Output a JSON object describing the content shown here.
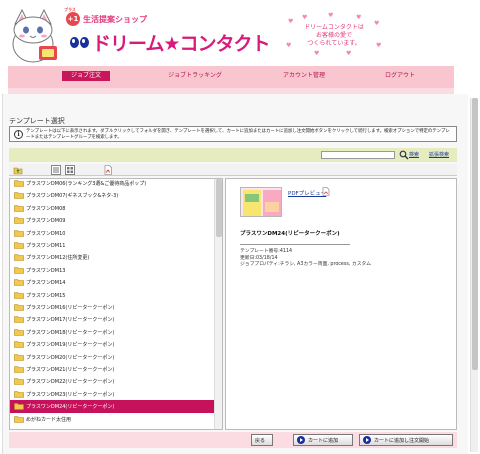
{
  "header": {
    "brand_badge_top": "プラス",
    "brand_badge": "+1",
    "brand_sub": "生活提案ショップ",
    "brand_main": "ドリーム★コンタクト",
    "tagline_line1": "ドリームコンタクトは",
    "tagline_line2": "お客様の愛で",
    "tagline_line3": "つくられています。"
  },
  "nav": {
    "items": [
      {
        "label": "ジョブ注文"
      },
      {
        "label": "ジョブトラッキング"
      },
      {
        "label": "アカウント管理"
      },
      {
        "label": "ログアウト"
      }
    ]
  },
  "page": {
    "title": "テンプレート選択",
    "info_text": "テンプレートは以下に表示されます。ダブルクリックしてフォルダを開き、テンプレートを選択して、カートに追加またはカートに追加し注文開始ボタンをクリックして続行します。検索オプションで特定のテンプレートまたはテンプレートグループを検索します。"
  },
  "search": {
    "placeholder": "",
    "search_label": "検索",
    "advanced_label": "拡張検索"
  },
  "tree": {
    "items": [
      {
        "label": "プラスワンDM06(ランキング3選&ご優待商品ポップ)",
        "selected": false
      },
      {
        "label": "プラスワンDM07(ギネスブック&ネタ-3)",
        "selected": false
      },
      {
        "label": "プラスワンDM08",
        "selected": false
      },
      {
        "label": "プラスワンDM09",
        "selected": false
      },
      {
        "label": "プラスワンDM10",
        "selected": false
      },
      {
        "label": "プラスワンDM11",
        "selected": false
      },
      {
        "label": "プラスワンDM12(住所変更)",
        "selected": false
      },
      {
        "label": "プラスワンDM13",
        "selected": false
      },
      {
        "label": "プラスワンDM14",
        "selected": false
      },
      {
        "label": "プラスワンDM15",
        "selected": false
      },
      {
        "label": "プラスワンDM16(リピータークーポン)",
        "selected": false
      },
      {
        "label": "プラスワンDM17(リピータークーポン)",
        "selected": false
      },
      {
        "label": "プラスワンDM18(リピータークーポン)",
        "selected": false
      },
      {
        "label": "プラスワンDM19(リピータークーポン)",
        "selected": false
      },
      {
        "label": "プラスワンDM20(リピータークーポン)",
        "selected": false
      },
      {
        "label": "プラスワンDM21(リピータークーポン)",
        "selected": false
      },
      {
        "label": "プラスワンDM22(リピータークーポン)",
        "selected": false
      },
      {
        "label": "プラスワンDM23(リピータークーポン)",
        "selected": false
      },
      {
        "label": "プラスワンDM24(リピータークーポン)",
        "selected": true
      },
      {
        "label": "めがねカード太住用",
        "selected": false
      }
    ]
  },
  "preview": {
    "pdf_label": "PDFプレビュー",
    "template_name": "プラスワンDM24(リピータークーポン)",
    "template_number": "テンプレート番号:4114",
    "updated": "更新日:03/18/14",
    "properties": "ジョブプロパティ:チラシ, A3カラー両面, process, カスタム"
  },
  "buttons": {
    "back": "戻る",
    "add_to_cart": "カートに追加",
    "add_and_order": "カートに追加し注文開始"
  },
  "colors": {
    "brand_pink": "#c8165a",
    "nav_bg": "#f9c6cf",
    "search_bar": "#e7ecc0"
  }
}
